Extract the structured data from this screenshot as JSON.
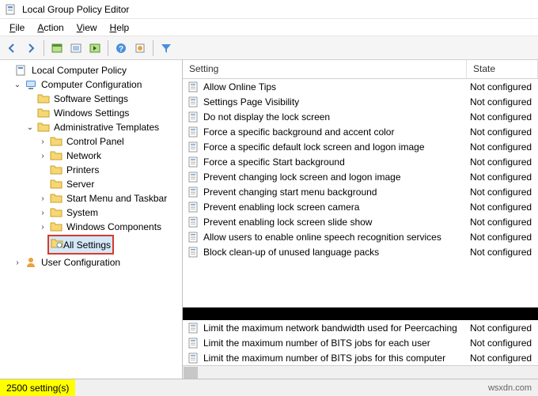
{
  "title_bar": {
    "title": "Local Group Policy Editor"
  },
  "menu": {
    "file": "File",
    "action": "Action",
    "view": "View",
    "help": "Help"
  },
  "tree": {
    "root": "Local Computer Policy",
    "comp_config": "Computer Configuration",
    "user_config": "User Configuration",
    "software_settings": "Software Settings",
    "windows_settings": "Windows Settings",
    "admin_templates": "Administrative Templates",
    "control_panel": "Control Panel",
    "network": "Network",
    "printers": "Printers",
    "server": "Server",
    "start_menu": "Start Menu and Taskbar",
    "system": "System",
    "win_components": "Windows Components",
    "all_settings": "All Settings"
  },
  "list": {
    "header_setting": "Setting",
    "header_state": "State",
    "rows": [
      {
        "setting": "Allow Online Tips",
        "state": "Not configured"
      },
      {
        "setting": "Settings Page Visibility",
        "state": "Not configured"
      },
      {
        "setting": "Do not display the lock screen",
        "state": "Not configured"
      },
      {
        "setting": "Force a specific background and accent color",
        "state": "Not configured"
      },
      {
        "setting": "Force a specific default lock screen and logon image",
        "state": "Not configured"
      },
      {
        "setting": "Force a specific Start background",
        "state": "Not configured"
      },
      {
        "setting": "Prevent changing lock screen and logon image",
        "state": "Not configured"
      },
      {
        "setting": "Prevent changing start menu background",
        "state": "Not configured"
      },
      {
        "setting": "Prevent enabling lock screen camera",
        "state": "Not configured"
      },
      {
        "setting": "Prevent enabling lock screen slide show",
        "state": "Not configured"
      },
      {
        "setting": "Allow users to enable online speech recognition services",
        "state": "Not configured"
      },
      {
        "setting": "Block clean-up of unused language packs",
        "state": "Not configured"
      }
    ],
    "rows2": [
      {
        "setting": "Limit the maximum network bandwidth used for Peercaching",
        "state": "Not configured"
      },
      {
        "setting": "Limit the maximum number of BITS jobs for each user",
        "state": "Not configured"
      },
      {
        "setting": "Limit the maximum number of BITS jobs for this computer",
        "state": "Not configured"
      }
    ]
  },
  "status": {
    "count": "2500 setting(s)",
    "source": "wsxdn.com"
  }
}
